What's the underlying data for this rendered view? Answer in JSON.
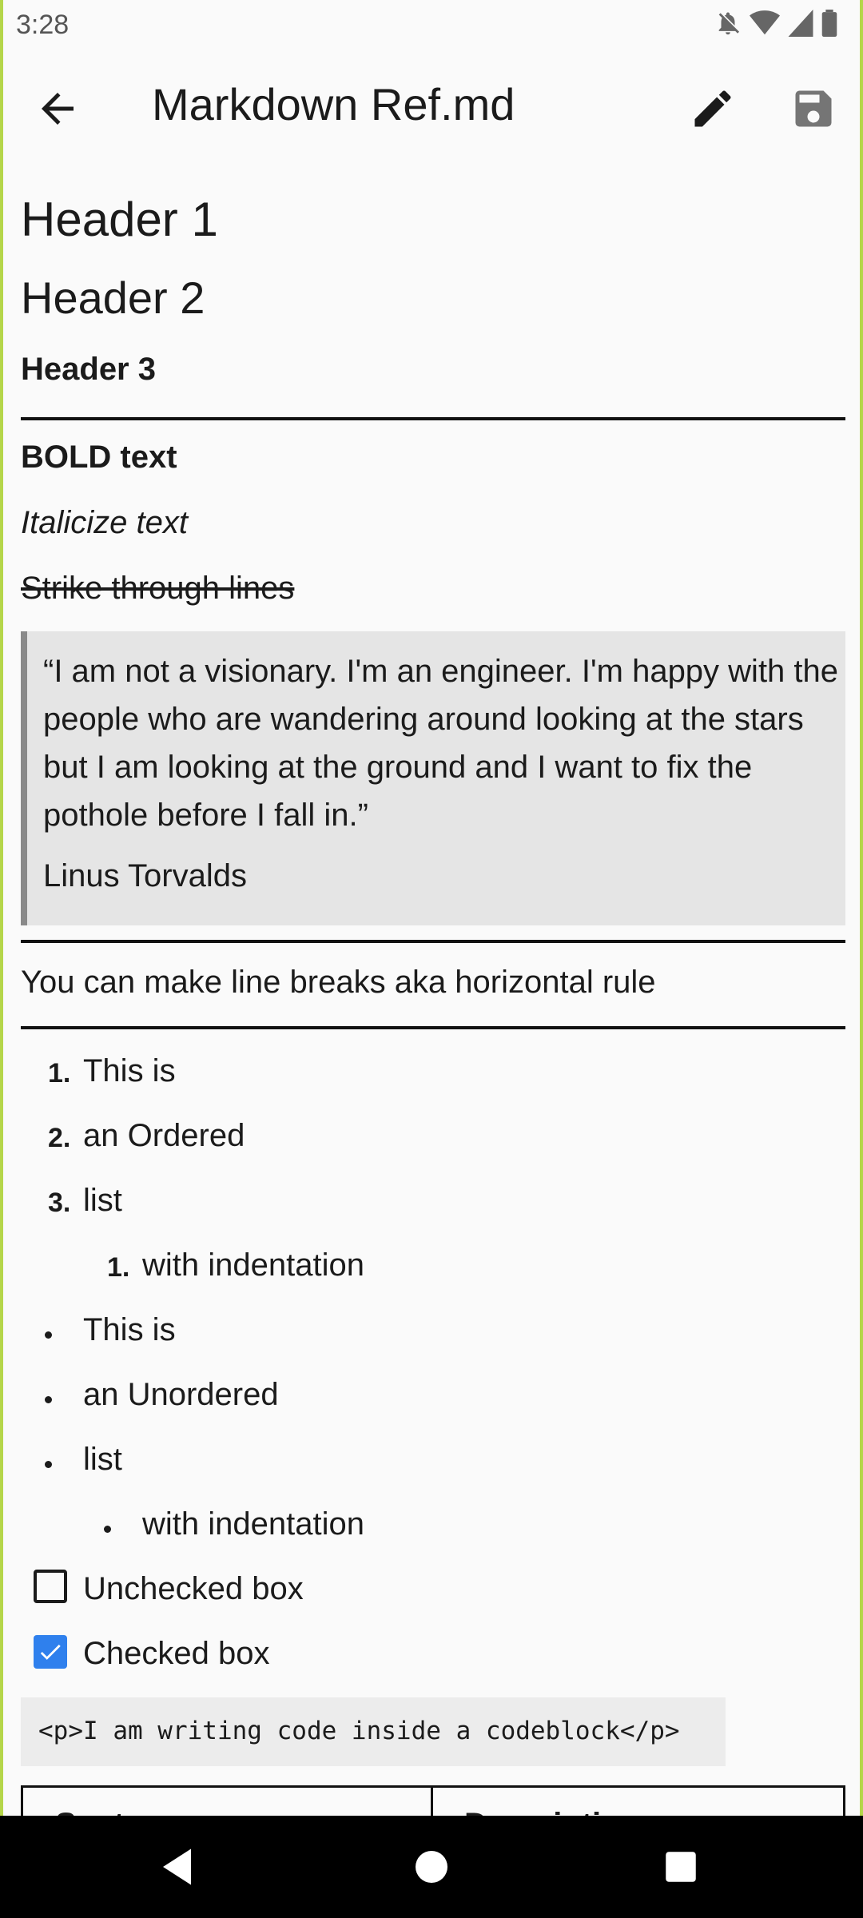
{
  "status_bar": {
    "time": "3:28"
  },
  "app_bar": {
    "title": "Markdown Ref.md"
  },
  "doc": {
    "h1": "Header 1",
    "h2": "Header 2",
    "h3": "Header 3",
    "bold": "BOLD text",
    "italic": "Italicize text",
    "strike": "Strike through lines",
    "quote": {
      "text": "“I am not a visionary. I'm an engineer. I'm happy with the people who are wandering around looking at the stars but I am looking at the ground and I want to fix the pothole before I fall in.”",
      "author": "Linus Torvalds"
    },
    "hr_text": "You can make line breaks aka horizontal rule",
    "ordered": [
      {
        "num": "1.",
        "text": "This is"
      },
      {
        "num": "2.",
        "text": "an Ordered"
      },
      {
        "num": "3.",
        "text": "list"
      },
      {
        "num": "1.",
        "text": "with indentation"
      }
    ],
    "unordered": [
      {
        "text": "This is"
      },
      {
        "text": "an Unordered"
      },
      {
        "text": "list"
      },
      {
        "text": "with indentation"
      }
    ],
    "checkboxes": [
      {
        "label": "Unchecked box",
        "checked": false
      },
      {
        "label": "Checked box",
        "checked": true
      }
    ],
    "code": "<p>I am writing code inside a codeblock</p>",
    "table": {
      "headers": [
        "Syntax",
        "Description"
      ]
    }
  },
  "colors": {
    "accent": "#2f80ed",
    "quote_bg": "#e5e5e5",
    "code_bg": "#ececec",
    "frame": "#b5d64a"
  }
}
